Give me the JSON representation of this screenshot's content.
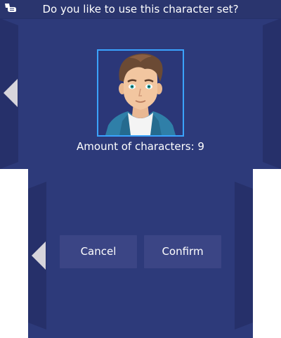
{
  "dialog": {
    "title": "Do you like to use this character set?",
    "character_count_label": "Amount of characters: 9"
  },
  "buttons": {
    "cancel": "Cancel",
    "confirm": "Confirm"
  },
  "icons": {
    "stylus": "stylus-hand-icon",
    "prev_top": "arrow-left-icon",
    "prev_bottom": "arrow-left-icon"
  },
  "colors": {
    "background": "#2d3a7a",
    "side_panels": "#26306a",
    "selection_border": "#3aa3ff",
    "button": "#3b4585",
    "text": "#ffffff"
  }
}
